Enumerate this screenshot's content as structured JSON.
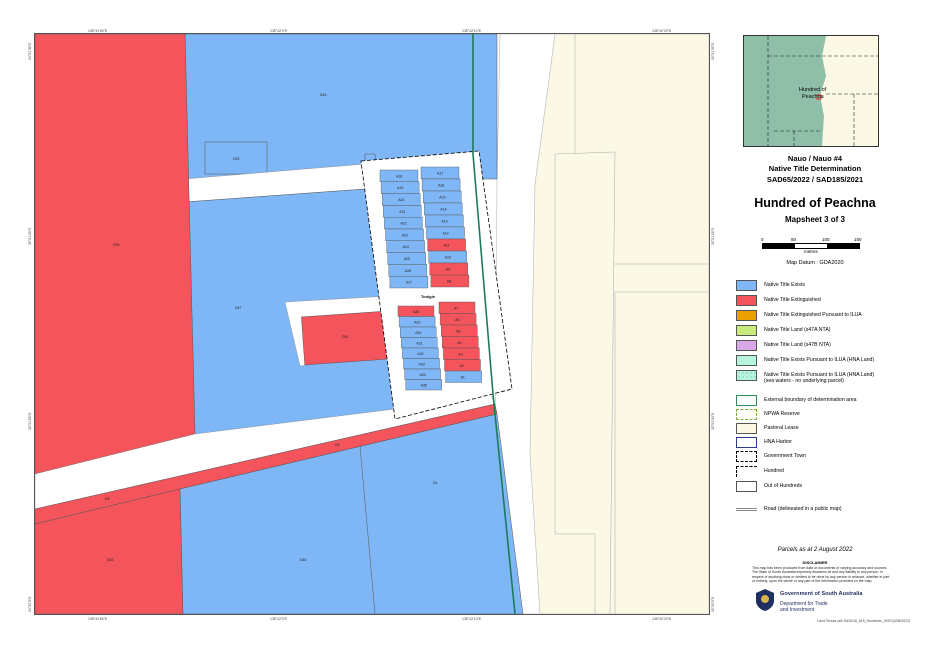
{
  "coords": {
    "top": [
      "135°41'50\"E",
      "135°42'0\"E",
      "135°42'10\"E",
      "135°42'20\"E"
    ],
    "bottom": [
      "135°41'50\"E",
      "135°42'0\"E",
      "135°42'10\"E",
      "135°42'20\"E"
    ],
    "left": [
      "32°51'30\"S",
      "32°51'40\"S",
      "32°51'50\"S",
      "32°52'0\"S"
    ],
    "right": [
      "32°51'30\"S",
      "32°51'40\"S",
      "32°51'50\"S",
      "32°52'0\"S"
    ]
  },
  "map": {
    "town_label": "Toolgie",
    "labels": {
      "large_red_nw": "D35",
      "blue_north": "D44",
      "small_top": "D29",
      "blue_west": "D47",
      "red_mid": "D31",
      "road_strip": "D6",
      "lower_strip": "D5",
      "red_sw": "D63",
      "blue_south": "D46",
      "blue_se": "D1"
    },
    "town_blocks": {
      "nw_column": [
        "A18",
        "A19",
        "A20",
        "A21",
        "A22",
        "A23",
        "A24",
        "A25",
        "A26",
        "A27"
      ],
      "ne_column": [
        "A17",
        "A16",
        "A15",
        "A14",
        "A13",
        "A12",
        "A11",
        "A10",
        "A9",
        "A8"
      ],
      "ne_red": [
        "A11",
        "A9",
        "A8"
      ],
      "sw_column": [
        "A28",
        "A29",
        "A30",
        "A31",
        "A32",
        "A33",
        "A34",
        "A35"
      ],
      "se_column": [
        "A7",
        "A6",
        "A5",
        "A4",
        "A3",
        "A2",
        "A1"
      ],
      "sw_red": [
        "A28"
      ],
      "se_red": [
        "A7",
        "A6",
        "A5",
        "A4",
        "A3",
        "A2"
      ]
    }
  },
  "inset": {
    "label_line1": "Hundred of",
    "label_line2": "Peachna"
  },
  "panel": {
    "title_line1": "Nauo / Nauo #4",
    "title_line2": "Native Title Determination",
    "title_line3": "SAD65/2022 / SAD185/2021",
    "hundred": "Hundred of Peachna",
    "mapsheet": "Mapsheet 3 of 3",
    "scale_ticks": [
      "0",
      "50",
      "100",
      "150"
    ],
    "scale_unit": "metres",
    "datum": "Map Datum : GDA2020",
    "parcels_date": "Parcels as at 2 August 2022",
    "disclaimer_heading": "DISCLAIMER",
    "disclaimer_text": "This map has been produced from data or documents of varying accuracy and sources. The State of South Australia expressly disclaims all and any liability to any person, in respect of anything done or omitted to be done by any person in reliance, whether in part or entirely, upon the whole or any part of the information provided on the map.",
    "gov_name": "Government of South Australia",
    "gov_dept_line1": "Department for Trade",
    "gov_dept_line2": "and Investment",
    "file_info": "Land Tenure.pdf  SA20/18_615_Hundreds_2020 [4/08/2022]"
  },
  "legend": [
    {
      "label": "Native Title Exists",
      "color": "#7fb6f5"
    },
    {
      "label": "Native Title Extinguished",
      "color": "#f4545c"
    },
    {
      "label": "Native Title Extinguished Pursuant to ILUA",
      "color": "#e8a100"
    },
    {
      "label": "Native Title Land (s47A NTA)",
      "color": "#c9ea7c"
    },
    {
      "label": "Native Title Land (s47B NTA)",
      "color": "#d7a7e6"
    },
    {
      "label": "Native Title Exists Pursuant to ILUA (HNA Land)",
      "color": "#b6f5dc"
    },
    {
      "label": "Native Title Exists Pursuant to ILUA (HNA Land)",
      "label2": "(sea waters - no underlying parcel)",
      "color": "#b6f5dc"
    },
    {
      "label": "External boundary of determination area",
      "color": "#2e8b57"
    },
    {
      "label": "NPWA Reserve",
      "color": "#c9ea7c"
    },
    {
      "label": "Pastoral Lease",
      "color": "#fbf8e6"
    },
    {
      "label": "HNA Harbor",
      "color": "#2a3b8f"
    },
    {
      "label": "Government Town",
      "color": "#000000"
    },
    {
      "label": "Hundred",
      "color": "#000000"
    },
    {
      "label": "Out of Hundreds",
      "color": "#ffffff"
    },
    {
      "label": "Road (delineated in a public map)",
      "color": "#888888"
    }
  ]
}
